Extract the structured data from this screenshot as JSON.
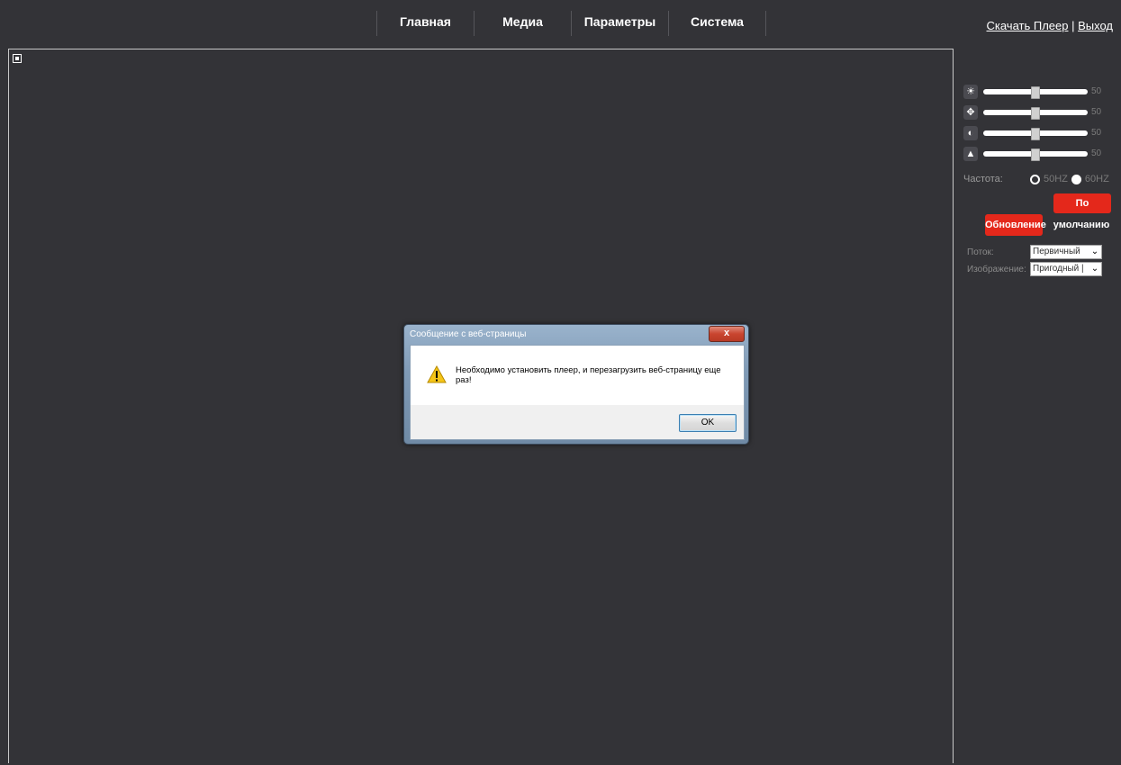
{
  "nav": {
    "items": [
      {
        "label": "Главная"
      },
      {
        "label": "Медиа"
      },
      {
        "label": "Параметры"
      },
      {
        "label": "Система"
      }
    ]
  },
  "top_links": {
    "download_player": "Скачать Плеер",
    "separator": " | ",
    "logout": "Выход"
  },
  "panel": {
    "sliders": [
      {
        "icon": "brightness-icon",
        "value": 50,
        "value_label": "50"
      },
      {
        "icon": "saturation-icon",
        "value": 50,
        "value_label": "50"
      },
      {
        "icon": "contrast-icon",
        "value": 50,
        "value_label": "50"
      },
      {
        "icon": "sharpness-icon",
        "value": 50,
        "value_label": "50"
      }
    ],
    "frequency": {
      "label": "Частота:",
      "options": [
        "50HZ",
        "60HZ"
      ],
      "selected": "50HZ"
    },
    "buttons": {
      "default_top": "По",
      "default_bottom": "умолчанию",
      "refresh": "Обновление"
    },
    "stream": {
      "label": "Поток:",
      "value": "Первичный"
    },
    "image": {
      "label": "Изображение:",
      "value": "Пригодный |"
    }
  },
  "dialog": {
    "title": "Сообщение с веб-страницы",
    "close_label": "x",
    "message": "Необходимо установить плеер, и перезагрузить веб-страницу еще раз!",
    "ok_label": "OK"
  },
  "colors": {
    "background": "#333337",
    "accent_red": "#e4281b",
    "text_white": "#ffffff"
  }
}
